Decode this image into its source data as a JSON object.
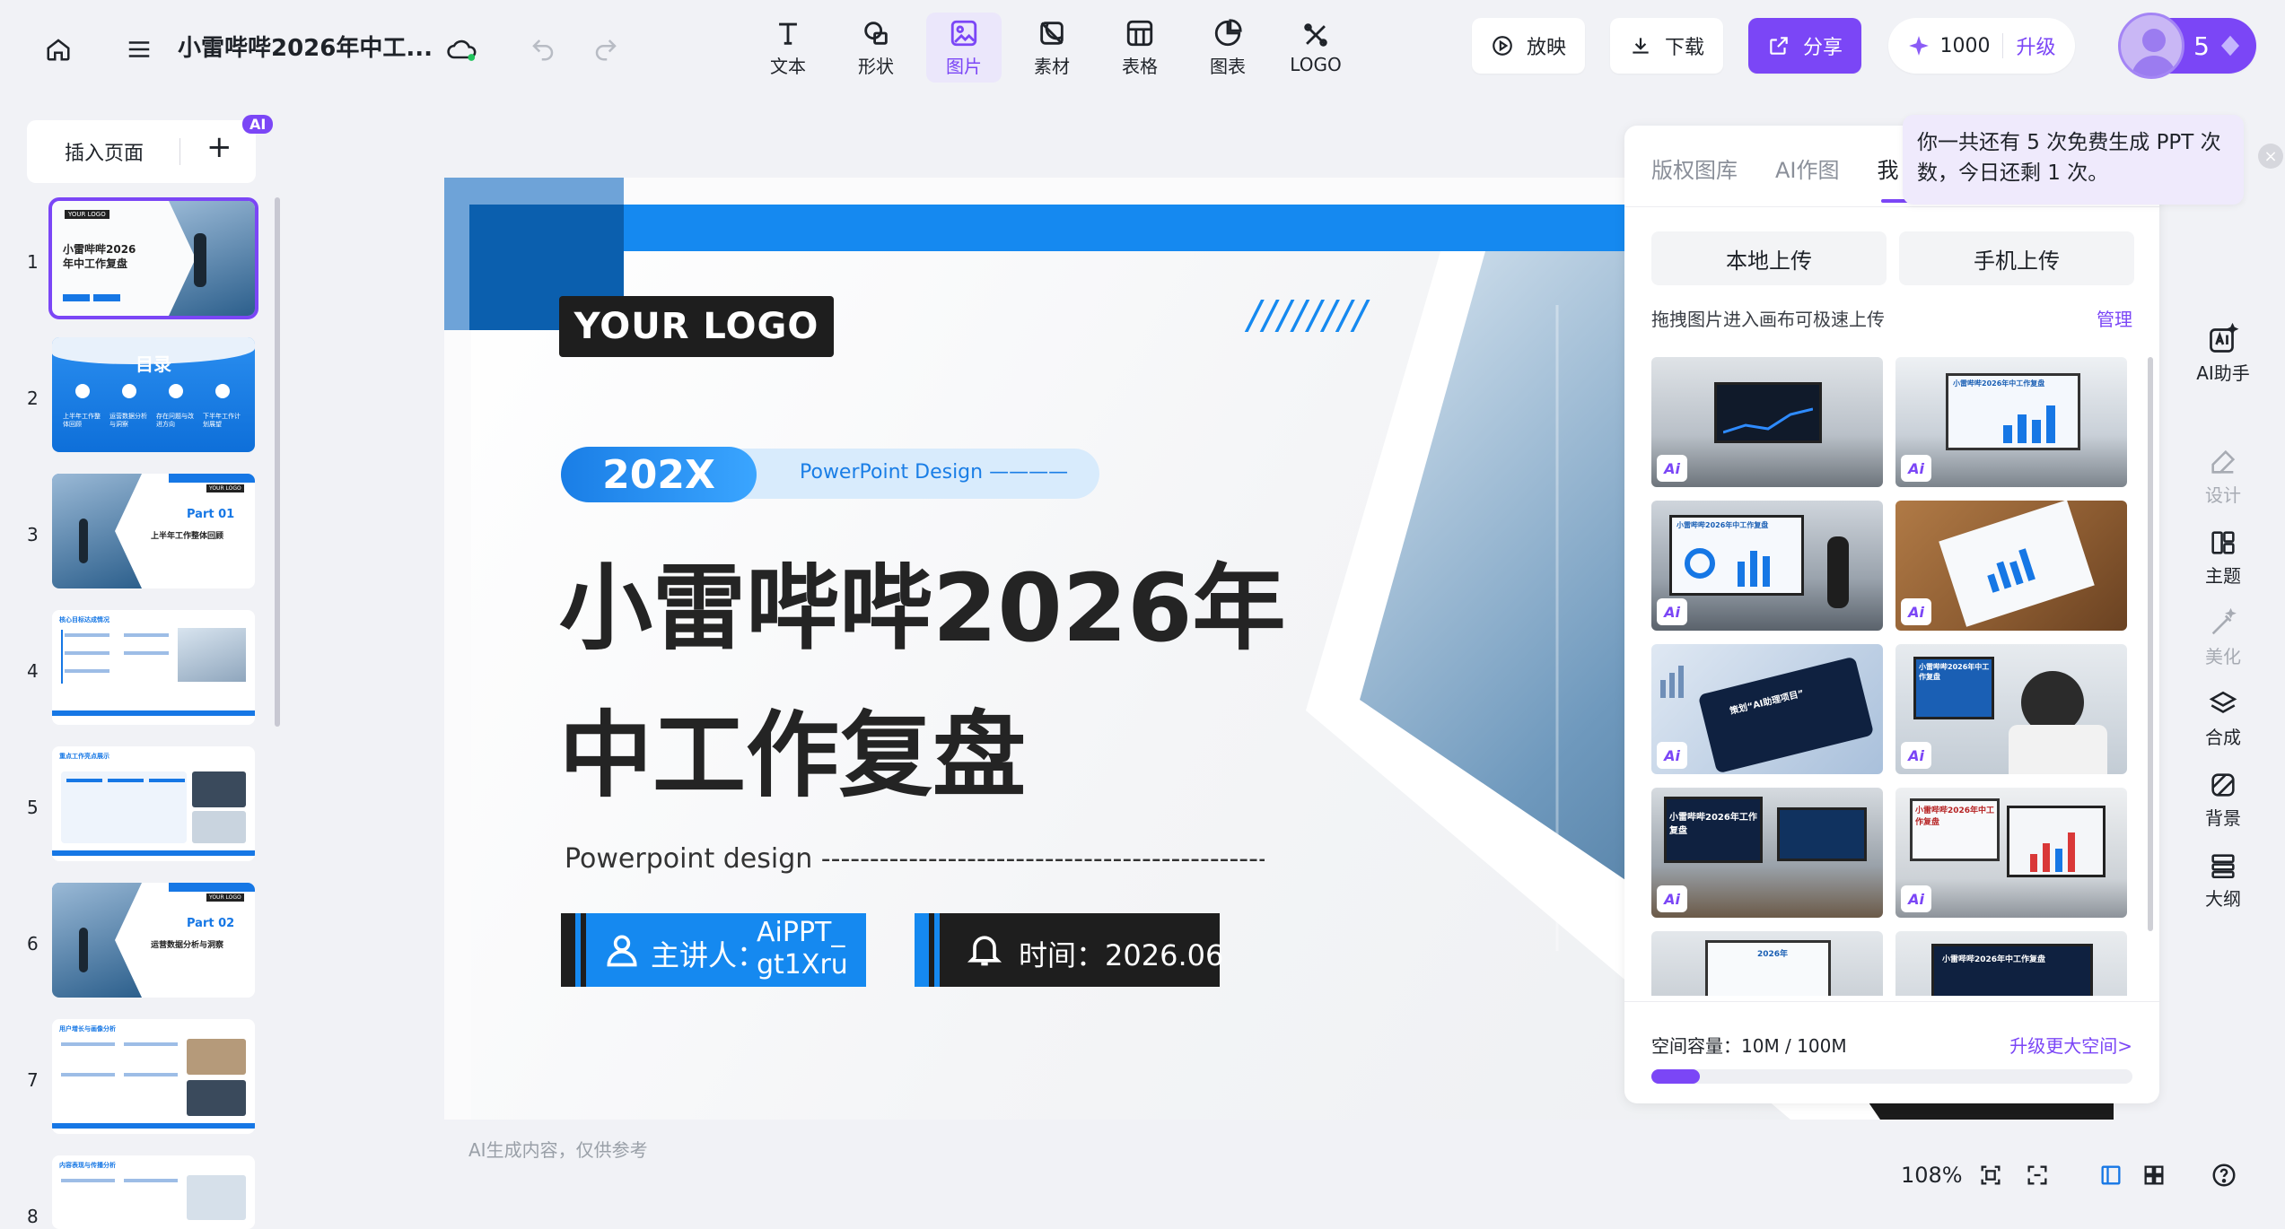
{
  "toolbar": {
    "doc_title": "小雷哔哔2026年中工...",
    "tools": [
      {
        "label": "文本",
        "icon": "text-icon"
      },
      {
        "label": "形状",
        "icon": "shape-icon"
      },
      {
        "label": "图片",
        "icon": "image-icon"
      },
      {
        "label": "素材",
        "icon": "asset-icon"
      },
      {
        "label": "表格",
        "icon": "table-icon"
      },
      {
        "label": "图表",
        "icon": "chart-icon"
      },
      {
        "label": "LOGO",
        "icon": "logo-icon"
      }
    ],
    "play_label": "放映",
    "download_label": "下载",
    "share_label": "分享",
    "credits": "1000",
    "upgrade_label": "升级",
    "user_count": "5",
    "accent": "#7b46f6"
  },
  "left": {
    "insert_label": "插入页面",
    "ai_badge": "AI",
    "pages": [
      {
        "num": "1",
        "title": "小雷哔哔2026年中工作复盘",
        "logo": "YOUR LOGO"
      },
      {
        "num": "2",
        "title": "目录",
        "items": [
          "上半年工作整体回顾",
          "运营数据分析与洞察",
          "存在问题与改进方向",
          "下半年工作计划展望"
        ]
      },
      {
        "num": "3",
        "part": "Part 01",
        "title": "上半年工作整体回顾",
        "logo": "YOUR LOGO"
      },
      {
        "num": "4",
        "title": "核心目标达成情况"
      },
      {
        "num": "5",
        "title": "重点工作亮点展示"
      },
      {
        "num": "6",
        "part": "Part 02",
        "title": "运营数据分析与洞察",
        "logo": "YOUR LOGO"
      },
      {
        "num": "7",
        "title": "用户增长与画像分析"
      },
      {
        "num": "8",
        "title": "内容表现与传播分析"
      }
    ]
  },
  "slide": {
    "logo_text": "YOUR LOGO",
    "year_badge": "202X",
    "pp_design": "PowerPoint Design ————",
    "title_line1": "小雷哔哔2026年",
    "title_line2": "中工作复盘",
    "subtitle": "Powerpoint design ------------------------------------------------------",
    "presenter_label": "主讲人：",
    "presenter_name_1": "AiPPT_",
    "presenter_name_2": "gt1Xru",
    "time_label": "时间：2026.06",
    "slashes": "////////",
    "disclaimer": "AI生成内容，仅供参考"
  },
  "image_panel": {
    "tabs": [
      "版权图库",
      "AI作图",
      "我"
    ],
    "active_tab": 2,
    "upload_local": "本地上传",
    "upload_phone": "手机上传",
    "hint": "拖拽图片进入画布可极速上传",
    "manage": "管理",
    "ai_tag": "Ai",
    "storage": "空间容量：10M / 100M",
    "storage_used_fraction": 0.1,
    "upgrade_space": "升级更大空间>",
    "images": [
      {
        "kind": "office-screen-dark",
        "ai": true,
        "screen_text": ""
      },
      {
        "kind": "office-screen-chart",
        "ai": true,
        "screen_text": "小雷哔哔2026年中工作复盘"
      },
      {
        "kind": "presenter-office",
        "ai": true,
        "screen_text": "小雷哔哔2026年中工作复盘"
      },
      {
        "kind": "paper-on-desk",
        "ai": true,
        "screen_text": ""
      },
      {
        "kind": "tablet-blue",
        "ai": true,
        "screen_text": "策划“AI助理项目”"
      },
      {
        "kind": "man-at-desk",
        "ai": true,
        "screen_text": "小雷哔哔2026年中工作复盘"
      },
      {
        "kind": "meeting-room-tv",
        "ai": true,
        "screen_text": "小雷哔哔2026年工作复盘"
      },
      {
        "kind": "monitor-chart",
        "ai": true,
        "screen_text": "小雷哔哔2026年中工作复盘"
      },
      {
        "kind": "screen-150",
        "ai": false,
        "screen_text": "2026年"
      },
      {
        "kind": "office-tv",
        "ai": false,
        "screen_text": "小雷哔哔2026年中工作复盘"
      }
    ]
  },
  "tooltip": {
    "text_line1": "你一共还有 5 次免费生成 PPT 次",
    "text_line2": "数，今日还剩 1 次。",
    "close": "×"
  },
  "right_tools": [
    {
      "label": "AI助手",
      "icon": "ai-assistant-icon",
      "dim": false
    },
    {
      "label": "设计",
      "icon": "design-icon",
      "dim": true
    },
    {
      "label": "主题",
      "icon": "theme-icon",
      "dim": false
    },
    {
      "label": "美化",
      "icon": "beautify-icon",
      "dim": true
    },
    {
      "label": "合成",
      "icon": "merge-icon",
      "dim": false
    },
    {
      "label": "背景",
      "icon": "background-icon",
      "dim": false
    },
    {
      "label": "大纲",
      "icon": "outline-icon",
      "dim": false
    }
  ],
  "bottom": {
    "zoom": "108%",
    "help": "?"
  }
}
